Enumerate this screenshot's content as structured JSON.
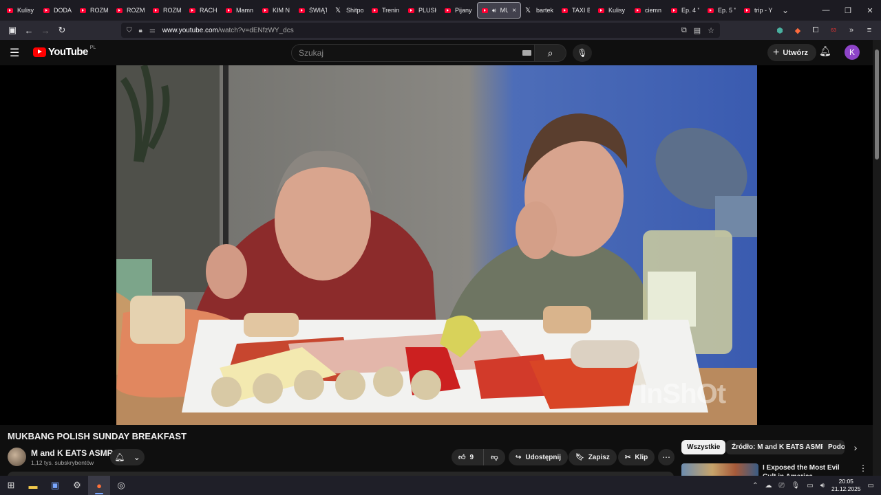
{
  "browser": {
    "tabs": [
      {
        "label": "Kulisy j",
        "icon": "youtube-icon"
      },
      {
        "label": "DODA",
        "icon": "youtube-icon"
      },
      {
        "label": "ROZM",
        "icon": "youtube-icon"
      },
      {
        "label": "ROZM",
        "icon": "youtube-icon"
      },
      {
        "label": "ROZM",
        "icon": "youtube-icon"
      },
      {
        "label": "RACH",
        "icon": "youtube-icon"
      },
      {
        "label": "Mamn",
        "icon": "youtube-icon"
      },
      {
        "label": "KIM N",
        "icon": "youtube-icon"
      },
      {
        "label": "ŚWIĄT",
        "icon": "youtube-icon"
      },
      {
        "label": "Shitpo",
        "icon": "x-icon"
      },
      {
        "label": "Trenin",
        "icon": "youtube-icon"
      },
      {
        "label": "PLUSK",
        "icon": "youtube-icon"
      },
      {
        "label": "Pijany",
        "icon": "youtube-icon"
      },
      {
        "label": "MU",
        "icon": "youtube-icon",
        "active": true
      },
      {
        "label": "bartek",
        "icon": "x-icon"
      },
      {
        "label": "TAXI B",
        "icon": "youtube-icon"
      },
      {
        "label": "Kulisy",
        "icon": "youtube-icon"
      },
      {
        "label": "ciemn",
        "icon": "youtube-icon"
      },
      {
        "label": "Ep. 4 \"",
        "icon": "youtube-icon"
      },
      {
        "label": "Ep. 5 \"",
        "icon": "youtube-icon"
      },
      {
        "label": "trip - Y",
        "icon": "youtube-icon"
      }
    ],
    "url_host": "www.youtube.com",
    "url_path": "/watch?v=dENfzWY_dcs",
    "ext_badge": "63"
  },
  "youtube": {
    "logo_text": "YouTube",
    "country_code": "PL",
    "search_placeholder": "Szukaj",
    "create_label": "Utwórz",
    "avatar_letter": "K"
  },
  "video": {
    "title": "MUKBANG POLISH SUNDAY BREAKFAST",
    "watermark": "InShOt",
    "channel_name": "M and K EATS ASMR",
    "channel_subs": "1,12 tys. subskrybentów",
    "like_count": "9",
    "share_label": "Udostępnij",
    "save_label": "Zapisz",
    "clip_label": "Klip"
  },
  "sidebar": {
    "chips": [
      "Wszystkie",
      "Źródło: M and K EATS ASMR",
      "Podo"
    ],
    "rec_title": "I Exposed the Most Evil Cult in America"
  },
  "taskbar": {
    "time": "20:05",
    "date": "21.12.2025"
  }
}
